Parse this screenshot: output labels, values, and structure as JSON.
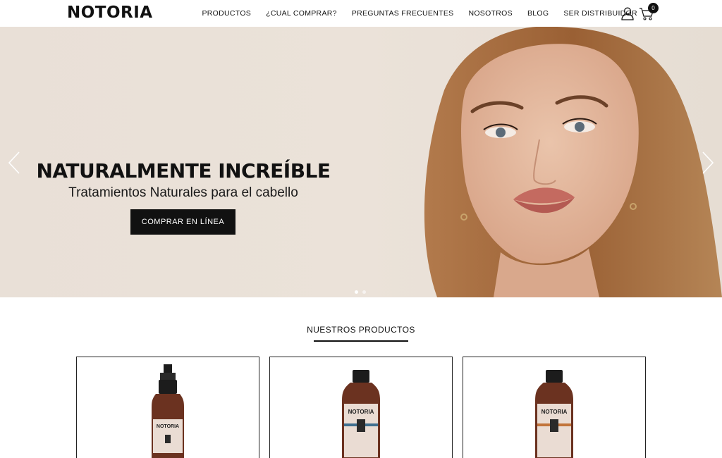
{
  "header": {
    "logo": "NOTORIA",
    "nav": [
      "PRODUCTOS",
      "¿CUAL COMPRAR?",
      "PREGUNTAS FRECUENTES",
      "NOSOTROS",
      "BLOG",
      "SER DISTRIBUIDOR"
    ],
    "cart_count": "0",
    "icons": [
      "user-icon",
      "cart-icon"
    ]
  },
  "hero": {
    "title": "NATURALMENTE INCREÍBLE",
    "subtitle": "Tratamientos Naturales para el cabello",
    "button": "COMPRAR EN LÍNEA",
    "slides_total": 2,
    "active_slide": 1
  },
  "products": {
    "heading": "NUESTROS PRODUCTOS",
    "brand_on_label": "NOTORIA",
    "items": [
      {
        "type": "spray-bottle"
      },
      {
        "type": "shampoo-bottle",
        "accent": "#3f6f8f"
      },
      {
        "type": "shampoo-bottle",
        "accent": "#c2743a"
      }
    ]
  },
  "colors": {
    "primary": "#111111",
    "hero_bg": "#ebe2d9",
    "bottle_amber": "#6b3220",
    "label_bg": "#eadcd3"
  }
}
